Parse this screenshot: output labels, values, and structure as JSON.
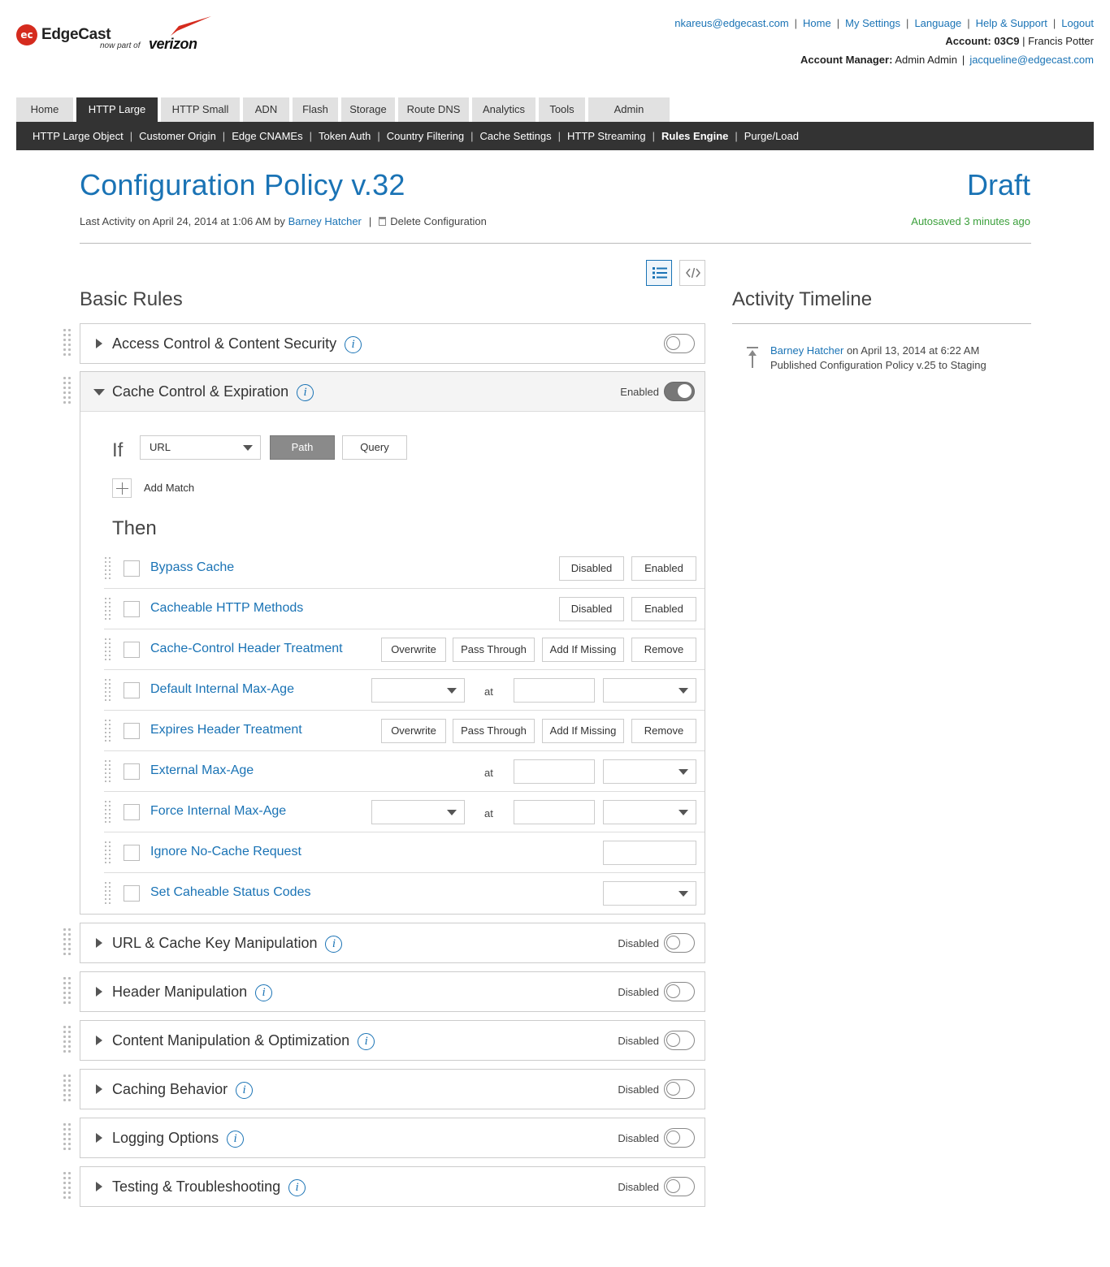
{
  "brand": {
    "badge": "ec",
    "name": "EdgeCast",
    "tagline": "now part of",
    "partner": "verizon"
  },
  "toplinks": [
    "nkareus@edgecast.com",
    "Home",
    "My Settings",
    "Language",
    "Help & Support",
    "Logout"
  ],
  "account": {
    "label": "Account:",
    "id": "03C9",
    "name": "Francis Potter"
  },
  "manager": {
    "label": "Account Manager:",
    "name": "Admin Admin",
    "email": "jacqueline@edgecast.com"
  },
  "tabs": [
    "Home",
    "HTTP Large",
    "HTTP Small",
    "ADN",
    "Flash",
    "Storage",
    "Route DNS",
    "Analytics",
    "Tools",
    "Admin"
  ],
  "active_tab": "HTTP Large",
  "subnav": [
    "HTTP Large Object",
    "Customer Origin",
    "Edge CNAMEs",
    "Token Auth",
    "Country Filtering",
    "Cache Settings",
    "HTTP Streaming",
    "Rules Engine",
    "Purge/Load"
  ],
  "active_subnav": "Rules Engine",
  "page": {
    "title": "Configuration Policy v.32",
    "status": "Draft",
    "last_activity_prefix": "Last Activity on April 24, 2014 at 1:06 AM by",
    "last_activity_user": "Barney Hatcher",
    "delete_label": "Delete Configuration",
    "autosaved": "Autosaved 3 minutes ago"
  },
  "basic_rules": {
    "heading": "Basic Rules",
    "panels": [
      {
        "title": "Access Control & Content Security",
        "status": "",
        "enabled": false,
        "expanded": false
      },
      {
        "title": "Cache Control & Expiration",
        "status": "Enabled",
        "enabled": true,
        "expanded": true
      },
      {
        "title": "URL & Cache Key Manipulation",
        "status": "Disabled",
        "enabled": false,
        "expanded": false
      },
      {
        "title": "Header Manipulation",
        "status": "Disabled",
        "enabled": false,
        "expanded": false
      },
      {
        "title": "Content Manipulation & Optimization",
        "status": "Disabled",
        "enabled": false,
        "expanded": false
      },
      {
        "title": "Caching Behavior",
        "status": "Disabled",
        "enabled": false,
        "expanded": false
      },
      {
        "title": "Logging Options",
        "status": "Disabled",
        "enabled": false,
        "expanded": false
      },
      {
        "title": "Testing & Troubleshooting",
        "status": "Disabled",
        "enabled": false,
        "expanded": false
      }
    ]
  },
  "condition": {
    "if_label": "If",
    "match_select": "URL",
    "path_btn": "Path",
    "query_btn": "Query",
    "add_match": "Add Match",
    "then_label": "Then"
  },
  "actions": [
    {
      "name": "Bypass Cache",
      "buttons": [
        "Disabled",
        "Enabled"
      ]
    },
    {
      "name": "Cacheable HTTP Methods",
      "buttons": [
        "Disabled",
        "Enabled"
      ]
    },
    {
      "name": "Cache-Control Header Treatment",
      "buttons": [
        "Overwrite",
        "Pass Through",
        "Add If Missing",
        "Remove"
      ]
    },
    {
      "name": "Default Internal Max-Age",
      "at": "at"
    },
    {
      "name": "Expires Header Treatment",
      "buttons": [
        "Overwrite",
        "Pass Through",
        "Add If Missing",
        "Remove"
      ]
    },
    {
      "name": "External Max-Age",
      "at": "at"
    },
    {
      "name": "Force Internal Max-Age",
      "at": "at"
    },
    {
      "name": "Ignore No-Cache Request"
    },
    {
      "name": "Set Caheable Status Codes"
    }
  ],
  "timeline": {
    "heading": "Activity Timeline",
    "items": [
      {
        "user": "Barney Hatcher",
        "when": "on April 13, 2014 at 6:22 AM",
        "desc": "Published Configuration Policy v.25 to Staging"
      }
    ]
  },
  "colors": {
    "link": "#1a73b5",
    "nav_dark": "#333333",
    "autosave": "#3ca03c"
  },
  "icons": [
    "list-view-icon",
    "code-view-icon",
    "info-icon",
    "trash-icon",
    "publish-icon",
    "drag-grip-icon",
    "caret-right-icon",
    "caret-down-icon",
    "plus-icon",
    "chevron-down-icon"
  ]
}
